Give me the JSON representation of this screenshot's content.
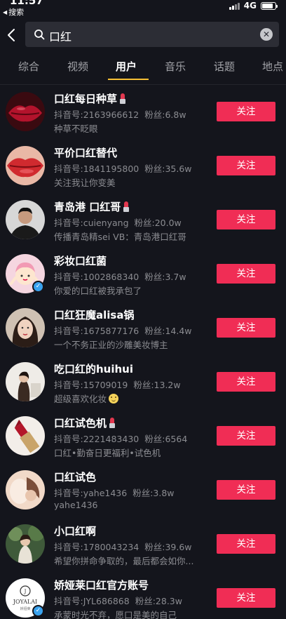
{
  "status_bar": {
    "time": "11:57",
    "back_label": "搜索",
    "network": "4G",
    "battery_level": 0.85
  },
  "search": {
    "query": "口红"
  },
  "tabs": [
    {
      "label": "综合",
      "active": false
    },
    {
      "label": "视频",
      "active": false
    },
    {
      "label": "用户",
      "active": true
    },
    {
      "label": "音乐",
      "active": false
    },
    {
      "label": "话题",
      "active": false
    },
    {
      "label": "地点",
      "active": false
    }
  ],
  "colors": {
    "follow_button": "#f02d55",
    "tab_indicator": "#f7c035",
    "background": "#14151c",
    "verified_badge": "#3aa3ef"
  },
  "follow_label": "关注",
  "users": [
    {
      "name": "口红每日种草",
      "badge": "lipstick-icon",
      "douyin_id": "抖音号:2163966612",
      "fans": "粉丝:6.8w",
      "desc": "种草不眨眼",
      "verified": false
    },
    {
      "name": "平价口红替代",
      "douyin_id": "抖音号:1841195800",
      "fans": "粉丝:35.6w",
      "desc": "关注我让你变美",
      "verified": false
    },
    {
      "name": "青岛港 口红哥",
      "badge": "lipstick-icon",
      "douyin_id": "抖音号:cuienyang",
      "fans": "粉丝:20.0w",
      "desc": "传播青岛精sei VB：青岛港口红哥",
      "verified": false
    },
    {
      "name": "彩妆口红菌",
      "douyin_id": "抖音号:1002868340",
      "fans": "粉丝:3.7w",
      "desc": "你爱的口红被我承包了",
      "verified": true
    },
    {
      "name": "口红狂魔alisa锅",
      "douyin_id": "抖音号:1675877176",
      "fans": "粉丝:14.4w",
      "desc": "一个不务正业的沙雕美妆博主",
      "verified": false
    },
    {
      "name": "吃口红的huihui",
      "douyin_id": "抖音号:15709019",
      "fans": "粉丝:13.2w",
      "desc": "超级喜欢化妆",
      "desc_emoji": "smile-emoji-icon",
      "verified": false
    },
    {
      "name": "口红试色机",
      "badge": "lipstick-icon",
      "douyin_id": "抖音号:2221483430",
      "fans": "粉丝:6564",
      "desc": "口红•勤奋日更福利•试色机",
      "verified": false
    },
    {
      "name": "口红试色",
      "douyin_id": "抖音号:yahe1436",
      "fans": "粉丝:3.8w",
      "desc": "yahe1436",
      "verified": false
    },
    {
      "name": "小口红啊",
      "douyin_id": "抖音号:1780043234",
      "fans": "粉丝:39.6w",
      "desc": "希望你拼命争取的，最后都会如你...",
      "verified": false
    },
    {
      "name": "娇娅莱口红官方账号",
      "douyin_id": "抖音号:JYL686868",
      "fans": "粉丝:28.3w",
      "desc": "承蒙时光不弃，愿口是美的自己",
      "verified": true,
      "avatar_logo_text": "JOYALAI",
      "avatar_logo_subtext": "娇娅莱"
    }
  ]
}
